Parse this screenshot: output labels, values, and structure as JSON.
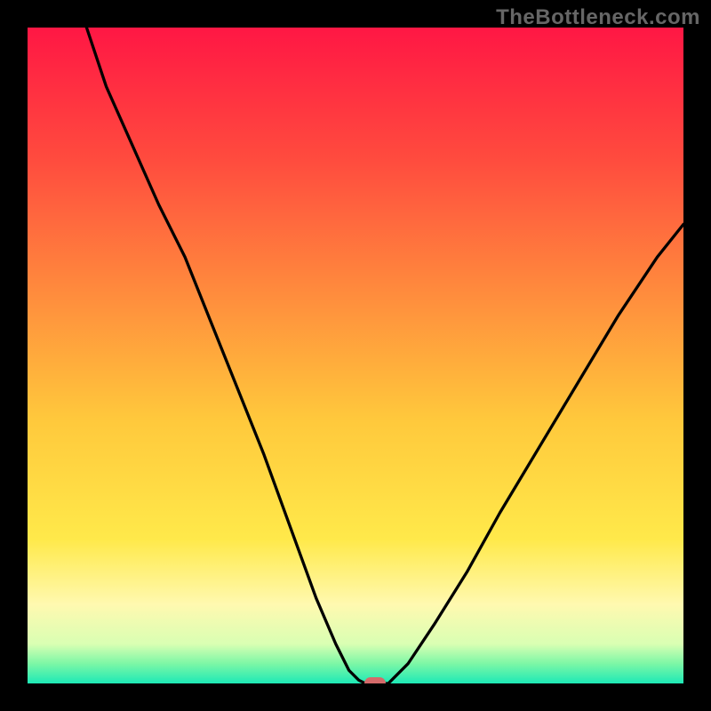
{
  "watermark": "TheBottleneck.com",
  "chart_data": {
    "type": "line",
    "title": "",
    "xlabel": "",
    "ylabel": "",
    "xlim": [
      0,
      100
    ],
    "ylim": [
      0,
      100
    ],
    "gradient_stops": [
      {
        "pos": 0,
        "color": "#ff1744"
      },
      {
        "pos": 20,
        "color": "#ff4b3e"
      },
      {
        "pos": 40,
        "color": "#ff8a3d"
      },
      {
        "pos": 60,
        "color": "#ffc93c"
      },
      {
        "pos": 78,
        "color": "#ffe94a"
      },
      {
        "pos": 88,
        "color": "#fff9b0"
      },
      {
        "pos": 94,
        "color": "#d9ffb3"
      },
      {
        "pos": 97,
        "color": "#7cf7a6"
      },
      {
        "pos": 100,
        "color": "#1de9b6"
      }
    ],
    "series": [
      {
        "name": "left-branch",
        "x": [
          9,
          12,
          16,
          20,
          24,
          28,
          32,
          36,
          40,
          44,
          47,
          49,
          50.5,
          51.5
        ],
        "y": [
          100,
          91,
          82,
          73,
          65,
          55,
          45,
          35,
          24,
          13,
          6,
          2,
          0.5,
          0
        ]
      },
      {
        "name": "floor",
        "x": [
          51.5,
          55
        ],
        "y": [
          0,
          0
        ]
      },
      {
        "name": "right-branch",
        "x": [
          55,
          58,
          62,
          67,
          72,
          78,
          84,
          90,
          96,
          100
        ],
        "y": [
          0,
          3,
          9,
          17,
          26,
          36,
          46,
          56,
          65,
          70
        ]
      }
    ],
    "marker": {
      "x": 53,
      "y": 0,
      "color": "#d46a6a"
    },
    "colors": {
      "line": "#000000",
      "background_frame": "#000000"
    }
  }
}
